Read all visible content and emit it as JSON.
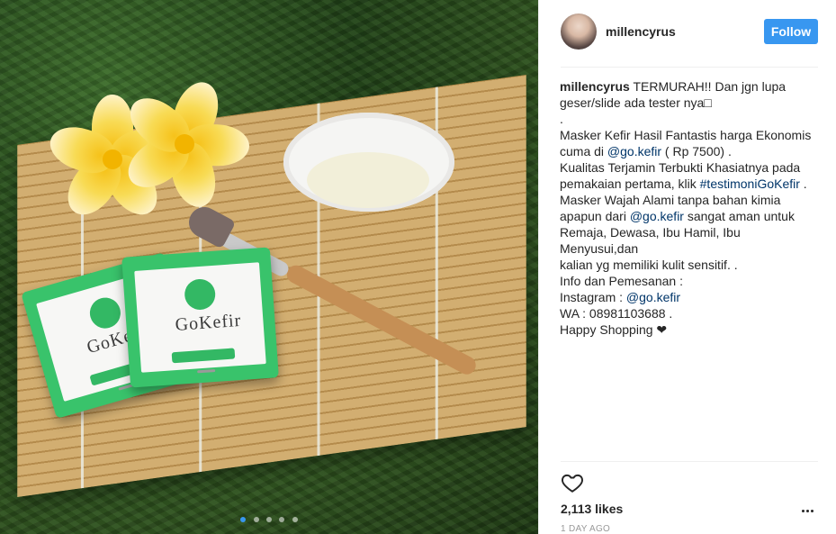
{
  "post": {
    "username": "millencyrus",
    "follow_label": "Follow",
    "caption": {
      "lines": [
        " TERMURAH!! Dan jgn lupa",
        "geser/slide ada tester nya□",
        ".",
        "Masker Kefir Hasil Fantastis harga Ekonomis",
        "cuma di ",
        "@go.kefir",
        " ( Rp 7500) .",
        "Kualitas Terjamin Terbukti Khasiatnya pada",
        "pemakaian pertama, klik ",
        "#testimoniGoKefir",
        " .",
        "Masker Wajah Alami tanpa bahan kimia",
        "apapun dari ",
        "@go.kefir",
        " sangat aman untuk",
        "Remaja, Dewasa, Ibu Hamil, Ibu Menyusui,dan",
        "kalian yg memiliki kulit sensitif. .",
        "Info dan Pemesanan :",
        "Instagram : ",
        "@go.kefir",
        "WA : 08981103688 .",
        "Happy Shopping ❤"
      ]
    },
    "likes": "2,113 likes",
    "time": "1 DAY AGO"
  },
  "image": {
    "sachet_brand": "GoKefir",
    "carousel_count": 5,
    "carousel_active": 1
  },
  "icons": {
    "like": "heart-outline-icon",
    "more": "more-options-icon"
  },
  "colors": {
    "accent": "#3897f0",
    "link": "#003569",
    "sachet_green": "#39c36b"
  }
}
